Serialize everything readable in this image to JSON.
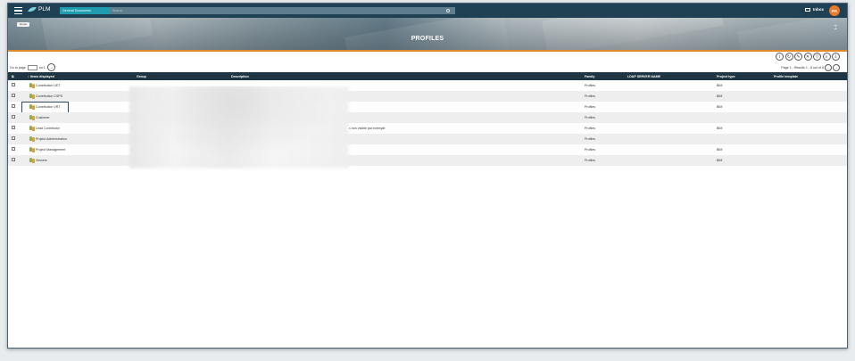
{
  "app": {
    "name": "PLM"
  },
  "search": {
    "scope": "General Documents",
    "placeholder": "Search"
  },
  "header": {
    "inbox_label": "Inbox",
    "avatar_initials": "PA"
  },
  "banner": {
    "back_label": "Home",
    "title": "PROFILES"
  },
  "pager": {
    "goto_label": "Go to page",
    "of_label": "on 1",
    "results_text": "Page 1 - Results 1 - 8 out of 8"
  },
  "table": {
    "columns": [
      "Items displayed",
      "Group",
      "Description",
      "Family",
      "LDAP SERVER NAME",
      "Project type",
      "Profile template"
    ],
    "rows": [
      {
        "name": "Contribution UET",
        "description": "",
        "family": "Profiles",
        "project_type": "BIM"
      },
      {
        "name": "Contribution CSPS",
        "description": "",
        "family": "Profiles",
        "project_type": "BIM"
      },
      {
        "name": "Contribution VRT",
        "description": "",
        "family": "Profiles",
        "project_type": "BIM"
      },
      {
        "name": "Customer",
        "description": "",
        "family": "Profiles",
        "project_type": ""
      },
      {
        "name": "Lead Contributor",
        "description": "s non visible par exemple",
        "family": "Profiles",
        "project_type": "BIM"
      },
      {
        "name": "Project Administration",
        "description": "",
        "family": "Profiles",
        "project_type": ""
      },
      {
        "name": "Project Management",
        "description": "",
        "family": "Profiles",
        "project_type": "BIM"
      },
      {
        "name": "Viewers",
        "description": "",
        "family": "Profiles",
        "project_type": "BIM"
      }
    ]
  },
  "colors": {
    "topbar": "#1f4153",
    "accent": "#1f9db0",
    "orange": "#e2892e",
    "table_header": "#1f3543"
  }
}
